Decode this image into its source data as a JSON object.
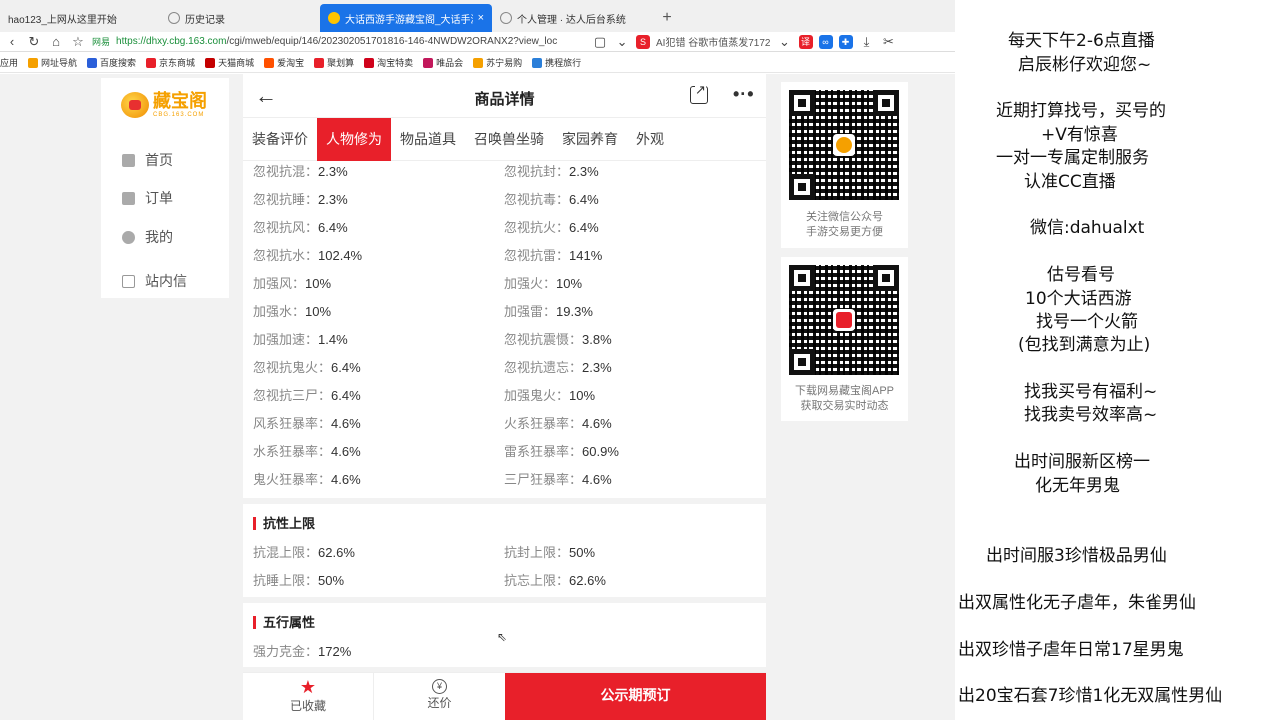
{
  "browser": {
    "tabs": [
      {
        "title": "hao123_上网从这里开始",
        "active": false
      },
      {
        "title": "历史记录",
        "active": false
      },
      {
        "title": "大话西游手游藏宝阁_大话手游交易",
        "active": true
      },
      {
        "title": "个人管理 · 达人后台系统",
        "active": false
      }
    ],
    "new_tab": "+",
    "close_glyph": "×",
    "address": {
      "secure_label": "网易",
      "url_host": "https://dhxy.cbg.163.com",
      "url_rest": "/cgi/mweb/equip/146/202302051701816-146-4NWDW2ORANX2?view_loc",
      "ext_label": "AI犯错 谷歌市值蒸发7172"
    },
    "bookmarks": [
      "应用",
      "网址导航",
      "百度搜索",
      "京东商城",
      "天猫商城",
      "爱淘宝",
      "聚划算",
      "淘宝特卖",
      "唯品会",
      "苏宁易购",
      "携程旅行"
    ]
  },
  "leftnav": {
    "logo_text": "藏宝阁",
    "logo_sub": "CBG.163.COM",
    "items": [
      "首页",
      "订单",
      "我的",
      "站内信"
    ]
  },
  "header": {
    "title": "商品详情"
  },
  "tabs": [
    "装备评价",
    "人物修为",
    "物品道具",
    "召唤兽坐骑",
    "家园养育",
    "外观"
  ],
  "attributes": [
    [
      {
        "k": "忽视抗混：",
        "v": "2.3%"
      },
      {
        "k": "忽视抗封：",
        "v": "2.3%"
      }
    ],
    [
      {
        "k": "忽视抗睡：",
        "v": "2.3%"
      },
      {
        "k": "忽视抗毒：",
        "v": "6.4%"
      }
    ],
    [
      {
        "k": "忽视抗风：",
        "v": "6.4%"
      },
      {
        "k": "忽视抗火：",
        "v": "6.4%"
      }
    ],
    [
      {
        "k": "忽视抗水：",
        "v": "102.4%"
      },
      {
        "k": "忽视抗雷：",
        "v": "141%"
      }
    ],
    [
      {
        "k": "加强风：",
        "v": "10%"
      },
      {
        "k": "加强火：",
        "v": "10%"
      }
    ],
    [
      {
        "k": "加强水：",
        "v": "10%"
      },
      {
        "k": "加强雷：",
        "v": "19.3%"
      }
    ],
    [
      {
        "k": "加强加速：",
        "v": "1.4%"
      },
      {
        "k": "忽视抗震慑：",
        "v": "3.8%"
      }
    ],
    [
      {
        "k": "忽视抗鬼火：",
        "v": "6.4%"
      },
      {
        "k": "忽视抗遗忘：",
        "v": "2.3%"
      }
    ],
    [
      {
        "k": "忽视抗三尸：",
        "v": "6.4%"
      },
      {
        "k": "加强鬼火：",
        "v": "10%"
      }
    ],
    [
      {
        "k": "风系狂暴率：",
        "v": "4.6%"
      },
      {
        "k": "火系狂暴率：",
        "v": "4.6%"
      }
    ],
    [
      {
        "k": "水系狂暴率：",
        "v": "4.6%"
      },
      {
        "k": "雷系狂暴率：",
        "v": "60.9%"
      }
    ],
    [
      {
        "k": "鬼火狂暴率：",
        "v": "4.6%"
      },
      {
        "k": "三尸狂暴率：",
        "v": "4.6%"
      }
    ]
  ],
  "resist_limit": {
    "title": "抗性上限",
    "rows": [
      [
        {
          "k": "抗混上限：",
          "v": "62.6%"
        },
        {
          "k": "抗封上限：",
          "v": "50%"
        }
      ],
      [
        {
          "k": "抗睡上限：",
          "v": "50%"
        },
        {
          "k": "抗忘上限：",
          "v": "62.6%"
        }
      ]
    ]
  },
  "five_elements": {
    "title": "五行属性",
    "rows": [
      [
        {
          "k": "强力克金：",
          "v": "172%"
        }
      ]
    ]
  },
  "bottom_bar": {
    "fav_label": "已收藏",
    "bargain_label": "还价",
    "primary_label": "公示期预订"
  },
  "qr_cards": [
    {
      "caption_1": "关注微信公众号",
      "caption_2": "手游交易更方便"
    },
    {
      "caption_1": "下载网易藏宝阁APP",
      "caption_2": "获取交易实时动态"
    }
  ],
  "overlay_lines": [
    "每天下午2-6点直播",
    "启辰彬仔欢迎您~",
    "近期打算找号，买号的",
    "+V有惊喜",
    "一对一专属定制服务",
    "认准CC直播",
    "微信:dahualxt",
    "估号看号",
    "10个大话西游",
    "找号一个火箭",
    "(包找到满意为止)",
    "找我买号有福利~",
    "找我卖号效率高~",
    "出时间服新区榜一",
    "化无年男鬼",
    "出时间服3珍惜极品男仙",
    "出双属性化无子虐年，朱雀男仙",
    "出双珍惜子虐年日常17星男鬼",
    "出20宝石套7珍惜1化无双属性男仙"
  ],
  "colors": {
    "accent": "#e8202a",
    "logo": "#f5a000",
    "tab_active": "#1a73e8"
  }
}
